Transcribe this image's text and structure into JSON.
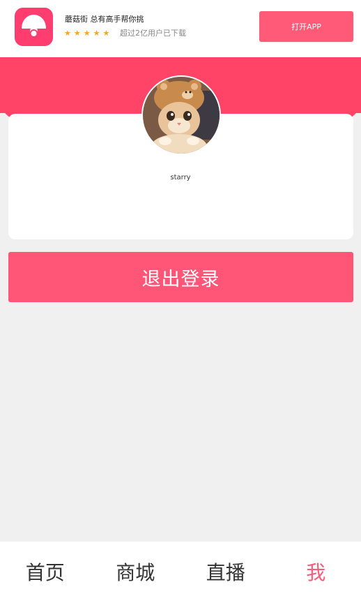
{
  "banner": {
    "app_name_line": "蘑菇街 总有高手帮你挑",
    "rating_stars": 5,
    "subtitle": "超过2亿用户已下载",
    "open_button": "打开APP"
  },
  "profile": {
    "username": "starry",
    "avatar_icon": "cat-avatar-image"
  },
  "logout_button": "退出登录",
  "tabbar": {
    "tabs": [
      {
        "label": "首页"
      },
      {
        "label": "商城"
      },
      {
        "label": "直播"
      },
      {
        "label": "我"
      }
    ],
    "active_index": 3
  },
  "colors": {
    "brand_pink": "#ff4467",
    "button_pink": "#ff5577",
    "active_tab": "#ff5a7a",
    "star": "#f5a623"
  }
}
